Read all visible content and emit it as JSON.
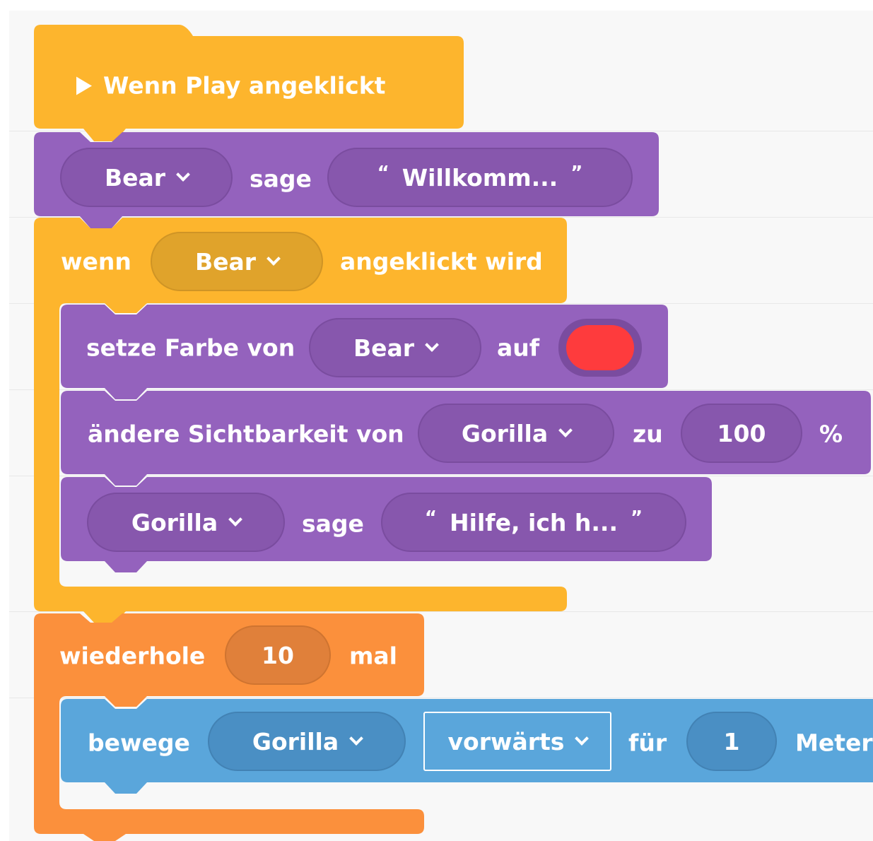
{
  "workspace": {
    "background": "#f8f8f8"
  },
  "colors": {
    "events": "#fdb52d",
    "looks": "#9462bd",
    "control": "#fb903c",
    "motion": "#5aa6db",
    "swatch_red": "#fe3b3d"
  },
  "blocks": {
    "when_play": {
      "icon": "play-icon",
      "label": "Wenn Play angeklickt"
    },
    "say1": {
      "sprite": "Bear",
      "verb": "sage",
      "text": "Willkomm..."
    },
    "when_clicked": {
      "prefix": "wenn",
      "sprite": "Bear",
      "suffix": "angeklickt wird"
    },
    "set_color": {
      "prefix": "setze Farbe von",
      "sprite": "Bear",
      "mid": "auf",
      "color": "#fe3b3d"
    },
    "change_visibility": {
      "prefix": "ändere Sichtbarkeit von",
      "sprite": "Gorilla",
      "mid": "zu",
      "value": "100",
      "unit": "%"
    },
    "say2": {
      "sprite": "Gorilla",
      "verb": "sage",
      "text": "Hilfe, ich h..."
    },
    "repeat": {
      "prefix": "wiederhole",
      "count": "10",
      "suffix": "mal"
    },
    "move": {
      "prefix": "bewege",
      "sprite": "Gorilla",
      "direction": "vorwärts",
      "mid": "für",
      "value": "1",
      "unit": "Meter"
    }
  },
  "quote_open": "“",
  "quote_close": "”"
}
